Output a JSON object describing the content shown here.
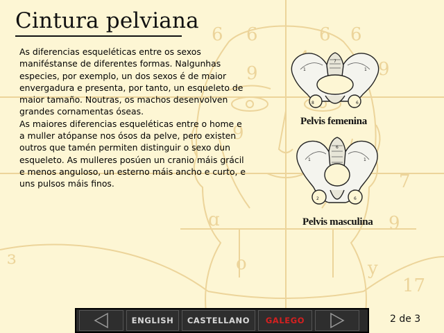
{
  "title": "Cintura pelviana",
  "paragraphs": [
    "As diferencias esqueléticas entre os sexos maniféstanse de diferentes formas. Nalgunhas especies, por exemplo, un dos sexos é de maior envergadura e presenta, por tanto, un esqueleto de maior tamaño. Noutras, os machos desenvolven grandes cornamentas óseas.",
    "As maiores diferencias esqueléticas entre o home e a muller atópanse nos ósos da pelve, pero existen outros que tamén permiten distinguir o sexo dun esqueleto. As mulleres posúen un cranio máis grácil e menos anguloso, un esterno máis ancho e curto, e uns pulsos máis finos."
  ],
  "figures": {
    "female_caption": "Pelvis femenina",
    "male_caption": "Pelvis masculina"
  },
  "navbar": {
    "prev_icon": "left-triangle-arrow",
    "next_icon": "right-triangle-arrow",
    "languages": [
      "ENGLISH",
      "CASTELLANO",
      "GALEGO"
    ],
    "active_language": "GALEGO"
  },
  "page_indicator": "2 de 3",
  "colors": {
    "background": "#fdf6d4",
    "sketch_lines": "#e8c98a",
    "active_language": "#d42020",
    "navbar": "#2a2a2a"
  }
}
